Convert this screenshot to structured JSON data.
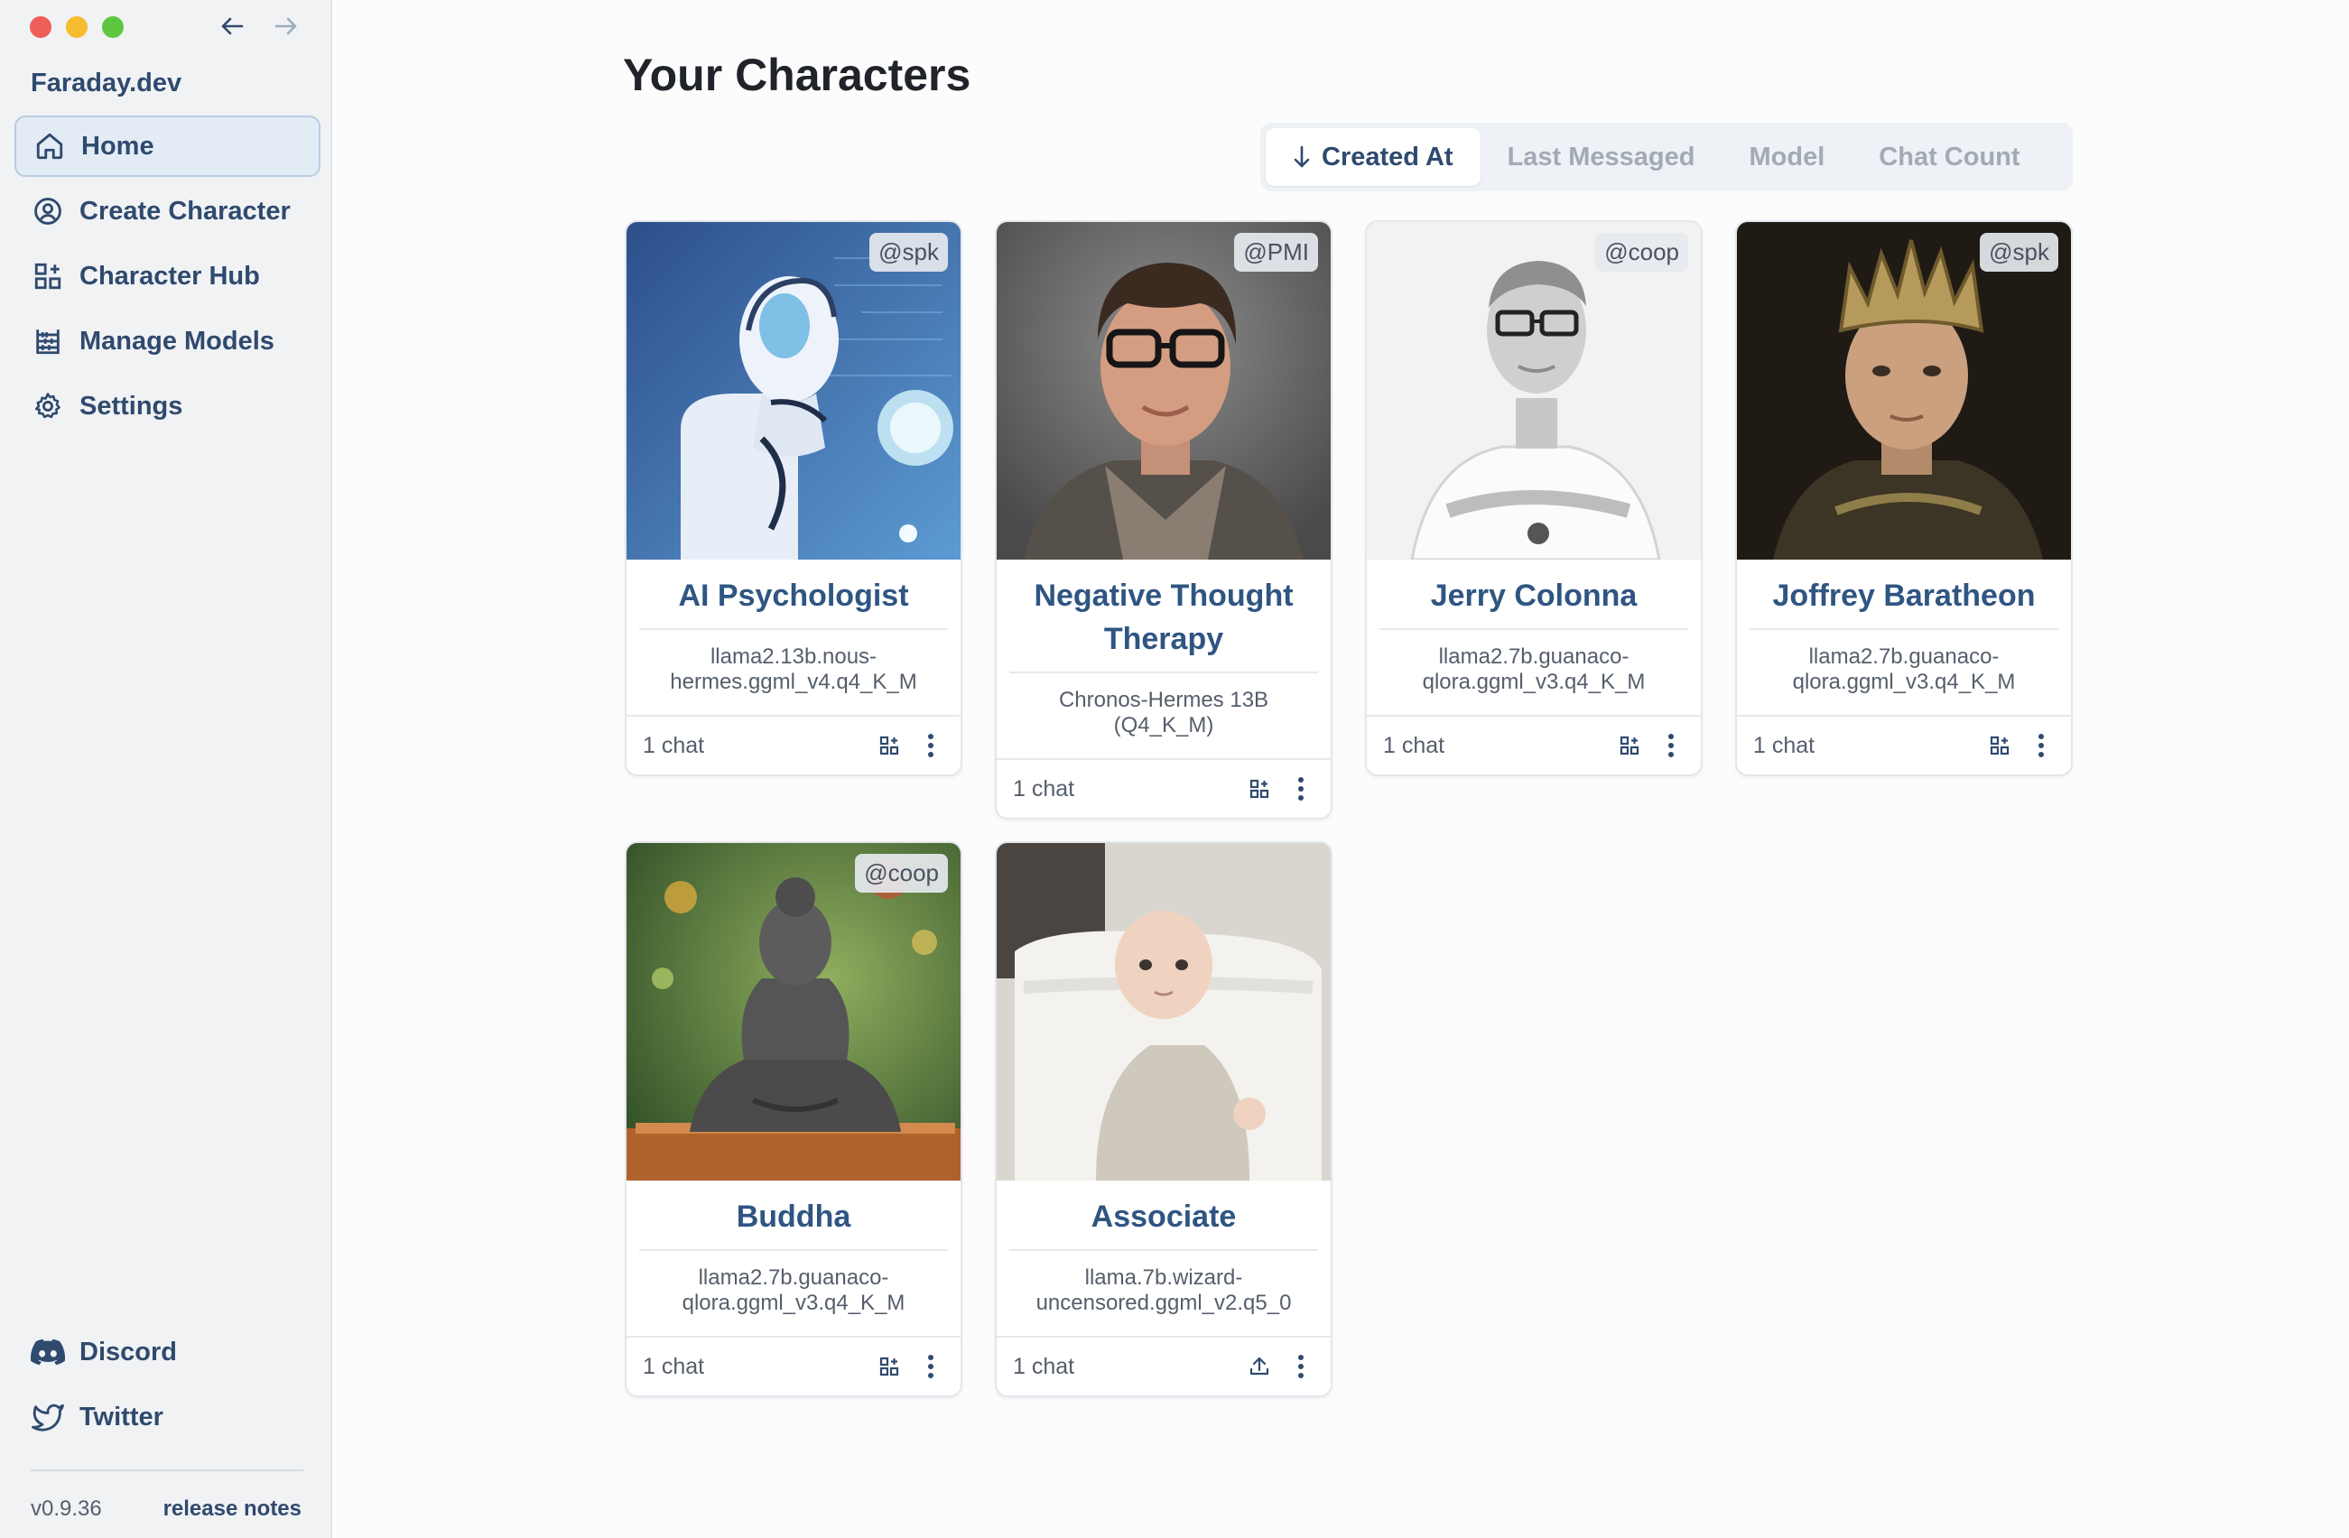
{
  "window": {
    "back_icon": "arrow-left-icon",
    "forward_icon": "arrow-right-icon"
  },
  "sidebar": {
    "brand": "Faraday.dev",
    "items": [
      {
        "label": "Home",
        "icon": "home-icon",
        "active": true
      },
      {
        "label": "Create Character",
        "icon": "user-circle-icon",
        "active": false
      },
      {
        "label": "Character Hub",
        "icon": "grid-plus-icon",
        "active": false
      },
      {
        "label": "Manage Models",
        "icon": "abacus-icon",
        "active": false
      },
      {
        "label": "Settings",
        "icon": "gear-icon",
        "active": false
      }
    ],
    "bottom": [
      {
        "label": "Discord",
        "icon": "discord-icon"
      },
      {
        "label": "Twitter",
        "icon": "twitter-icon"
      }
    ],
    "version": "v0.9.36",
    "release_notes": "release notes"
  },
  "main": {
    "title": "Your Characters",
    "sort": [
      {
        "label": "Created At",
        "active": true
      },
      {
        "label": "Last Messaged",
        "active": false
      },
      {
        "label": "Model",
        "active": false
      },
      {
        "label": "Chat Count",
        "active": false
      }
    ],
    "cards": [
      {
        "name": "AI Psychologist",
        "tag": "@spk",
        "model": "llama2.13b.nous-hermes.ggml_v4.q4_K_M",
        "chats": "1 chat",
        "action_icon": "grid-plus-icon"
      },
      {
        "name": "Negative Thought Therapy",
        "tag": "@PMI",
        "model": "Chronos-Hermes 13B (Q4_K_M)",
        "chats": "1 chat",
        "action_icon": "grid-plus-icon"
      },
      {
        "name": "Jerry Colonna",
        "tag": "@coop",
        "model": "llama2.7b.guanaco-qlora.ggml_v3.q4_K_M",
        "chats": "1 chat",
        "action_icon": "grid-plus-icon"
      },
      {
        "name": "Joffrey Baratheon",
        "tag": "@spk",
        "model": "llama2.7b.guanaco-qlora.ggml_v3.q4_K_M",
        "chats": "1 chat",
        "action_icon": "grid-plus-icon"
      },
      {
        "name": "Buddha",
        "tag": "@coop",
        "model": "llama2.7b.guanaco-qlora.ggml_v3.q4_K_M",
        "chats": "1 chat",
        "action_icon": "grid-plus-icon"
      },
      {
        "name": "Associate",
        "tag": "",
        "model": "llama.7b.wizard-uncensored.ggml_v2.q5_0",
        "chats": "1 chat",
        "action_icon": "upload-icon"
      }
    ]
  }
}
